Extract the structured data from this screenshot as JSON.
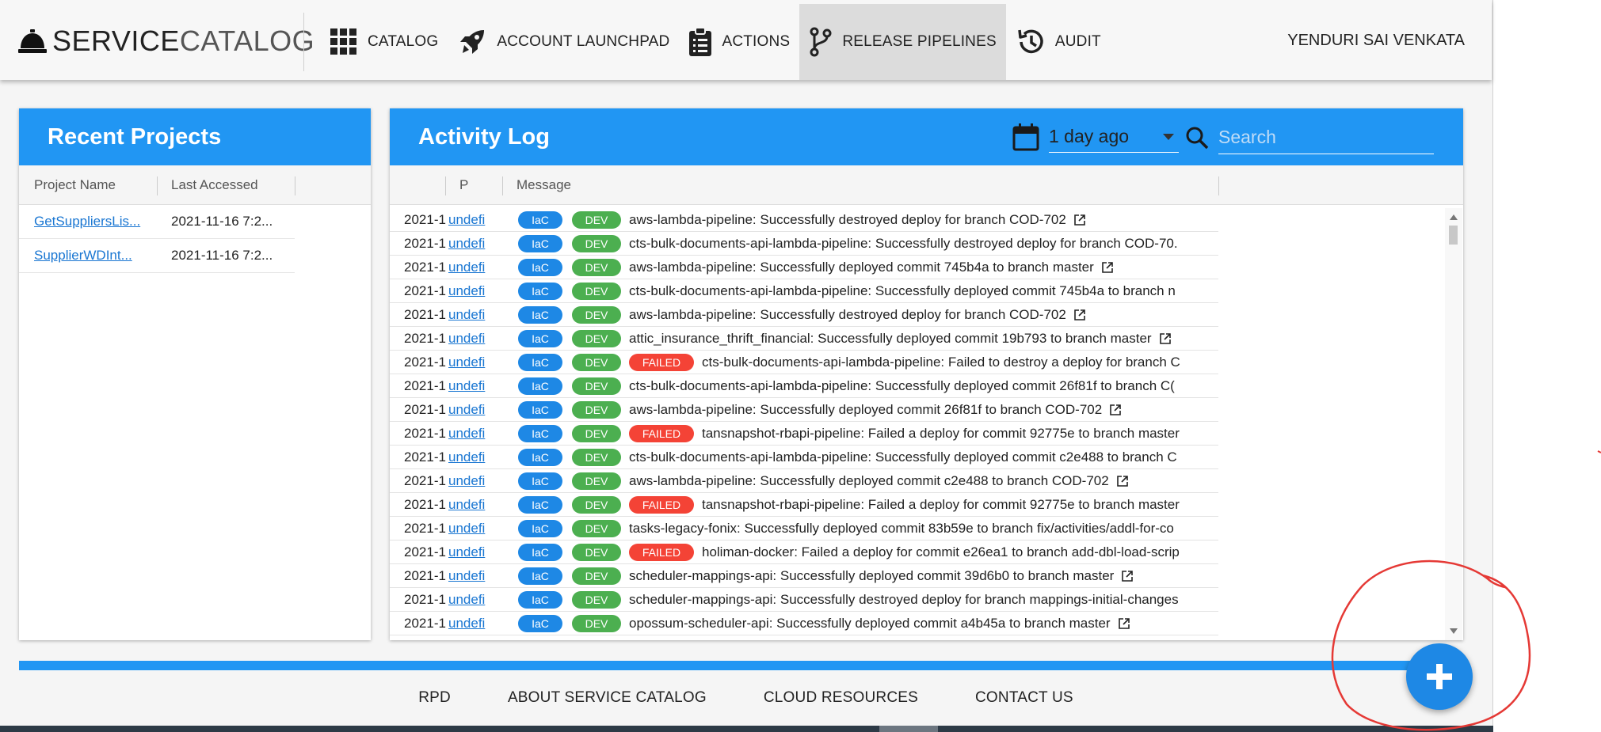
{
  "brand": {
    "part1": "SERVICE",
    "part2": "CATALOG"
  },
  "nav": {
    "catalog": "CATALOG",
    "launchpad": "ACCOUNT LAUNCHPAD",
    "actions": "ACTIONS",
    "pipelines": "RELEASE PIPELINES",
    "audit": "AUDIT"
  },
  "user": {
    "name": "YENDURI SAI VENKATA"
  },
  "recent": {
    "title": "Recent Projects",
    "columns": [
      "Project Name",
      "Last Accessed"
    ],
    "rows": [
      {
        "name": "GetSuppliersLis...",
        "accessed": "2021-11-16 7:2..."
      },
      {
        "name": "SupplierWDInt...",
        "accessed": "2021-11-16 7:2..."
      }
    ]
  },
  "activity": {
    "title": "Activity Log",
    "date_filter": "1 day ago",
    "search_placeholder": "Search",
    "columns": [
      "",
      "P",
      "Message"
    ],
    "rows": [
      {
        "date": "2021-1",
        "project": "undefi",
        "tag": "IaC",
        "env": "DEV",
        "failed": false,
        "message": "aws-lambda-pipeline: Successfully destroyed deploy for branch COD-702",
        "link": true
      },
      {
        "date": "2021-1",
        "project": "undefi",
        "tag": "IaC",
        "env": "DEV",
        "failed": false,
        "message": "cts-bulk-documents-api-lambda-pipeline: Successfully destroyed deploy for branch COD-70.",
        "link": false
      },
      {
        "date": "2021-1",
        "project": "undefi",
        "tag": "IaC",
        "env": "DEV",
        "failed": false,
        "message": "aws-lambda-pipeline: Successfully deployed commit 745b4a to branch master",
        "link": true
      },
      {
        "date": "2021-1",
        "project": "undefi",
        "tag": "IaC",
        "env": "DEV",
        "failed": false,
        "message": "cts-bulk-documents-api-lambda-pipeline: Successfully deployed commit 745b4a to branch n",
        "link": false
      },
      {
        "date": "2021-1",
        "project": "undefi",
        "tag": "IaC",
        "env": "DEV",
        "failed": false,
        "message": "aws-lambda-pipeline: Successfully destroyed deploy for branch COD-702",
        "link": true
      },
      {
        "date": "2021-1",
        "project": "undefi",
        "tag": "IaC",
        "env": "DEV",
        "failed": false,
        "message": "attic_insurance_thrift_financial: Successfully deployed commit 19b793 to branch master",
        "link": true
      },
      {
        "date": "2021-1",
        "project": "undefi",
        "tag": "IaC",
        "env": "DEV",
        "failed": true,
        "failed_label": "FAILED",
        "message": "cts-bulk-documents-api-lambda-pipeline: Failed to destroy a deploy for branch C",
        "link": false
      },
      {
        "date": "2021-1",
        "project": "undefi",
        "tag": "IaC",
        "env": "DEV",
        "failed": false,
        "message": "cts-bulk-documents-api-lambda-pipeline: Successfully deployed commit 26f81f to branch C(",
        "link": false
      },
      {
        "date": "2021-1",
        "project": "undefi",
        "tag": "IaC",
        "env": "DEV",
        "failed": false,
        "message": "aws-lambda-pipeline: Successfully deployed commit 26f81f to branch COD-702",
        "link": true
      },
      {
        "date": "2021-1",
        "project": "undefi",
        "tag": "IaC",
        "env": "DEV",
        "failed": true,
        "failed_label": "FAILED",
        "message": "tansnapshot-rbapi-pipeline: Failed a deploy for commit 92775e to branch master",
        "link": false
      },
      {
        "date": "2021-1",
        "project": "undefi",
        "tag": "IaC",
        "env": "DEV",
        "failed": false,
        "message": "cts-bulk-documents-api-lambda-pipeline: Successfully deployed commit c2e488 to branch C",
        "link": false
      },
      {
        "date": "2021-1",
        "project": "undefi",
        "tag": "IaC",
        "env": "DEV",
        "failed": false,
        "message": "aws-lambda-pipeline: Successfully deployed commit c2e488 to branch COD-702",
        "link": true
      },
      {
        "date": "2021-1",
        "project": "undefi",
        "tag": "IaC",
        "env": "DEV",
        "failed": true,
        "failed_label": "FAILED",
        "message": "tansnapshot-rbapi-pipeline: Failed a deploy for commit 92775e to branch master",
        "link": false
      },
      {
        "date": "2021-1",
        "project": "undefi",
        "tag": "IaC",
        "env": "DEV",
        "failed": false,
        "message": "tasks-legacy-fonix: Successfully deployed commit 83b59e to branch fix/activities/addl-for-co",
        "link": false
      },
      {
        "date": "2021-1",
        "project": "undefi",
        "tag": "IaC",
        "env": "DEV",
        "failed": true,
        "failed_label": "FAILED",
        "message": "holiman-docker: Failed a deploy for commit e26ea1 to branch add-dbl-load-scrip",
        "link": false
      },
      {
        "date": "2021-1",
        "project": "undefi",
        "tag": "IaC",
        "env": "DEV",
        "failed": false,
        "message": "scheduler-mappings-api: Successfully deployed commit 39d6b0 to branch master",
        "link": true
      },
      {
        "date": "2021-1",
        "project": "undefi",
        "tag": "IaC",
        "env": "DEV",
        "failed": false,
        "message": "scheduler-mappings-api: Successfully destroyed deploy for branch mappings-initial-changes",
        "link": false
      },
      {
        "date": "2021-1",
        "project": "undefi",
        "tag": "IaC",
        "env": "DEV",
        "failed": false,
        "message": "opossum-scheduler-api: Successfully deployed commit a4b45a to branch master",
        "link": true
      },
      {
        "date": "",
        "project": "",
        "tag": "",
        "env": "",
        "failed": false,
        "message": "",
        "link": false
      }
    ]
  },
  "footer": {
    "rpd": "RPD",
    "about": "ABOUT SERVICE CATALOG",
    "cloud": "CLOUD RESOURCES",
    "contact": "CONTACT US"
  },
  "colors": {
    "primary": "#2196f3",
    "iac_chip": "#1e88e5",
    "dev_chip": "#4caf50",
    "failed_chip": "#f44336",
    "annotation": "#e53935"
  },
  "icons": [
    "bell-icon",
    "grid-icon",
    "rocket-icon",
    "clipboard-icon",
    "branch-icon",
    "history-icon",
    "calendar-icon",
    "search-icon",
    "external-link-icon",
    "plus-icon"
  ]
}
